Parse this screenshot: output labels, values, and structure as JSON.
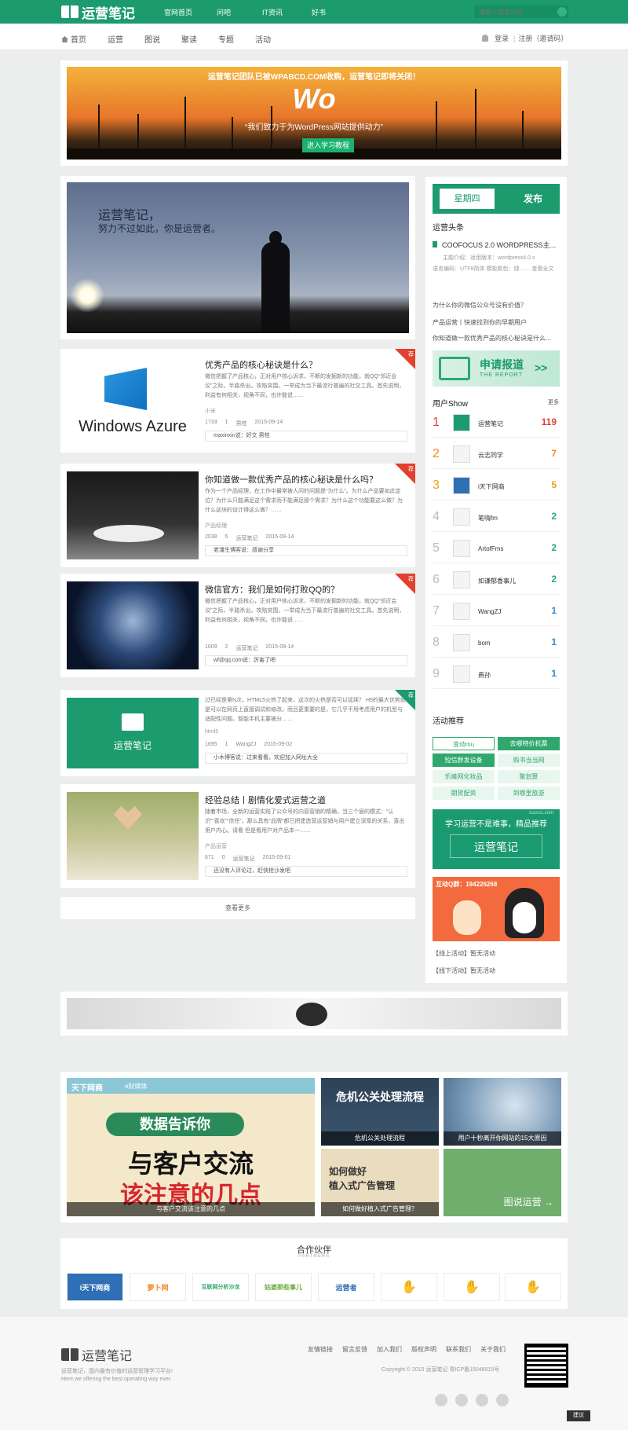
{
  "topbar": {
    "logo_text": "运营笔记",
    "nav": [
      "官网首页",
      "问吧",
      "IT资讯",
      "好书"
    ],
    "search_placeholder": "请输入搜索内容"
  },
  "subnav": {
    "items": [
      "首页",
      "运营",
      "图说",
      "聚读",
      "专题",
      "活动"
    ],
    "login": "登录",
    "register": "注册（邀请码）"
  },
  "banner": {
    "notice": "运营笔记团队已被WPABCD.COM收购，运营笔记即将关闭！",
    "logo": "Wo",
    "slogan": "“我们致力于为WordPress网站提供动力”",
    "button": "进入学习教程"
  },
  "hero": {
    "line1": "运营笔记，",
    "line2": "努力不过如此，你是运营者。"
  },
  "posts": [
    {
      "title": "优秀产品的核心秘诀是什么？",
      "excerpt": "微信把握了产品核心，正对用户核心诉求，不断的发掘新的功能，就QQ“邻近会议”之际，半路杀出，攻陷突围，一举成为当下最流行普遍的社交工具。首先说明，利益有何相关，视角不同，也许能说……",
      "tag": "小米",
      "views": "1733",
      "comments": "1",
      "author": "男桂",
      "date": "2015-09-14",
      "comment": "maxinxin说：好文 男桂",
      "thumb_text": "Windows Azure"
    },
    {
      "title": "你知道做一款优秀产品的核心秘诀是什么吗？",
      "excerpt": "作为一个产品经理，在工作中最常被人问的问题是“为什么”。为什么产品要如此定位？为什么只能满足这个需求而不能满足那个需求？为什么这个功能要这么做？为什么这块的设计得这么做？……",
      "tag": "产品经理",
      "views": "2038",
      "comments": "5",
      "author": "运营笔记",
      "date": "2015-09-14",
      "comment": "老潘生博客说：感谢分享"
    },
    {
      "title": "微信官方：我们是如何打败QQ的？",
      "excerpt": "微信把握了产品核心，正对用户核心诉求，不断的发掘新的功能，就QQ“邻近会议”之际，半路杀出，攻陷突围，一举成为当下最流行普遍的社交工具。首先说明，利益有何相关，视角不同，也许能说……",
      "tag": "",
      "views": "1609",
      "comments": "2",
      "author": "运营笔记",
      "date": "2015-09-14",
      "comment": "wf@qq.com说：厉害了吧"
    },
    {
      "title": "",
      "excerpt": "过已经是第N次，HTML5火热了起来，这次的火热是否可以延续？ H5的最大优势就是可以在网页上直接调试和修改，而且更重要的是，它几乎不用考虑用户的机型与适配性问题。智能手机主要被分……",
      "tag": "html5",
      "views": "1695",
      "comments": "1",
      "author": "WangZJ",
      "date": "2015-09-02",
      "comment": "小木博客说：过来看看，欢迎加入网址大全",
      "thumb_text": "运营笔记"
    },
    {
      "title": "经验总结丨剧情化爱式运营之道",
      "excerpt": "随着市场，全新的运营实践了公众号的内容营销的精确，当三个层的模式：“认识”“喜欢”“信任”，那么具有“品牌”都已把建造营运营销与用户建立深厚的关系，直击用户内心。请看 但是看用户对产品本一……",
      "tag": "产品运营",
      "views": "671",
      "comments": "0",
      "author": "运营笔记",
      "date": "2015-09-01",
      "comment": "还没有人评论过，赶快抢沙发吧"
    }
  ],
  "ribbon_label": "荐",
  "load_more": "查看更多",
  "sidebar": {
    "tab_active": "星期四",
    "tab_other": "发布",
    "headline_title": "运营头条",
    "top_news": "COOFOCUS 2.0 WORDPRESS主...",
    "top_news_desc1": "主题介绍：适用版本：wordpress4.0.x",
    "top_news_desc2": "语言编码：UTF8简体  模板颜色：绿……  查看全文",
    "news": [
      "为什么你的微信公众号没有价值？",
      "产品运营丨快速找到你的早期用户",
      "你知道做一款优秀产品的核心秘诀是什么..."
    ],
    "apply_title": "申请报道",
    "apply_sub": "THE REPORT",
    "apply_arrow": ">>",
    "user_show": "用户Show",
    "more": "更多",
    "ranks": [
      {
        "num": "1",
        "name": "运营笔记",
        "score": "119"
      },
      {
        "num": "2",
        "name": "云志同学",
        "score": "7"
      },
      {
        "num": "3",
        "name": "i天下网商",
        "score": "5"
      },
      {
        "num": "4",
        "name": "笔嗨fm",
        "score": "2"
      },
      {
        "num": "5",
        "name": "ArtofFms",
        "score": "2"
      },
      {
        "num": "6",
        "name": "如谦郁香事儿",
        "score": "2"
      },
      {
        "num": "7",
        "name": "WangZJ",
        "score": "1"
      },
      {
        "num": "8",
        "name": "bom",
        "score": "1"
      },
      {
        "num": "9",
        "name": "费孙",
        "score": "1"
      }
    ],
    "activity_title": "活动推荐",
    "activities": [
      "变动mu",
      "去哪特价机票",
      "短信群发设备",
      "购书当当网",
      "乐峰网化妆品",
      "聚划算",
      "期货配资",
      "到哪里旅游"
    ],
    "learn_line1": "学习运营不是难事，",
    "learn_line2": "精品推荐",
    "learn_site": "cccccc.com",
    "learn_logo": "运营笔记",
    "qq_group": "互动Q群：194226268",
    "offline": "【线上活动】暂无活动",
    "online": "【线下活动】暂无活动"
  },
  "gallery": {
    "big_brand": "天下网商",
    "big_brand2": "e财媒体",
    "big_title1": "数据告诉你",
    "big_title2": "与客户交流",
    "big_title3": "该注意的几点",
    "big_caption": "与客户交流该注意的几点",
    "g2_title": "危机公关处理流程",
    "g2_caption": "危机公关处理流程",
    "g3_caption": "用户十秒离开你网站的15大原因",
    "g4_title1": "如何做好",
    "g4_title2": "植入式广告管理",
    "g4_caption": "如何做好植入式广告管理？",
    "g5_caption": "图说运营 →"
  },
  "partners": {
    "title": "合作伙伴",
    "subtitle": "PARTNERS",
    "logos": [
      "i天下网商",
      "萝卜网",
      "互联网分析沙龙",
      "姑婆那些事儿",
      "运营者"
    ]
  },
  "footer": {
    "logo": "运营笔记",
    "links": [
      "友情链接",
      "留言反馈",
      "加入我们",
      "版权声明",
      "联系我们",
      "关于我们"
    ],
    "desc1": "运营笔记，国内最有价值的运营管理学习平台!",
    "desc2": "Here,we offering the best operating way ever.",
    "copyright": "Copyright © 2015 运营笔记  粤ICP备15048915号",
    "feedback": "建议"
  },
  "colors": {
    "brand_green": "#1c9b6e",
    "ribbon_red": "#e2412f",
    "rank_red": "#e2412f",
    "rank_orange": "#f08a24",
    "rank_yellow": "#e8a21a",
    "rank_green": "#2fa86e"
  }
}
